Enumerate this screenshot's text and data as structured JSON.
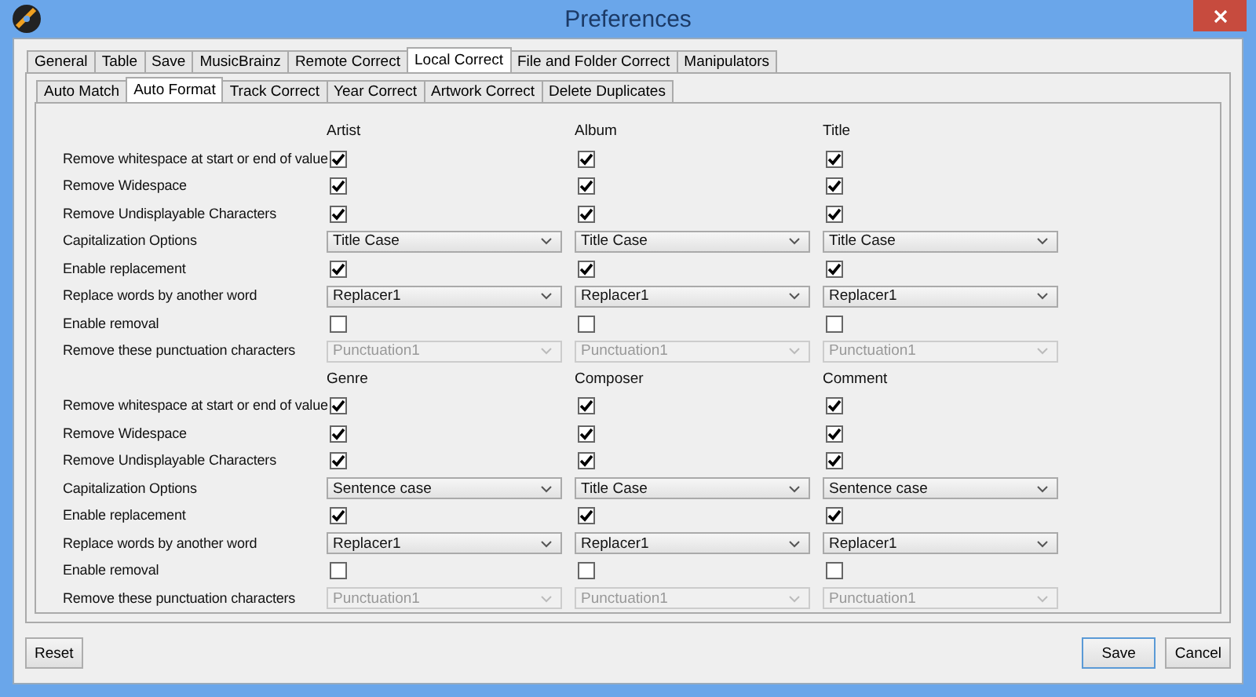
{
  "window": {
    "title": "Preferences"
  },
  "tabs": [
    {
      "label": "General",
      "selected": false
    },
    {
      "label": "Table",
      "selected": false
    },
    {
      "label": "Save",
      "selected": false
    },
    {
      "label": "MusicBrainz",
      "selected": false
    },
    {
      "label": "Remote Correct",
      "selected": false
    },
    {
      "label": "Local Correct",
      "selected": true
    },
    {
      "label": "File and Folder Correct",
      "selected": false
    },
    {
      "label": "Manipulators",
      "selected": false
    }
  ],
  "subtabs": [
    {
      "label": "Auto Match",
      "selected": false
    },
    {
      "label": "Auto Format",
      "selected": true
    },
    {
      "label": "Track Correct",
      "selected": false
    },
    {
      "label": "Year Correct",
      "selected": false
    },
    {
      "label": "Artwork Correct",
      "selected": false
    },
    {
      "label": "Delete Duplicates",
      "selected": false
    }
  ],
  "groups": [
    {
      "columns": [
        "Artist",
        "Album",
        "Title"
      ],
      "rows": [
        {
          "label": "Remove whitespace at start or end of value",
          "kind": "checkbox",
          "cells": [
            {
              "checked": true
            },
            {
              "checked": true
            },
            {
              "checked": true
            }
          ]
        },
        {
          "label": "Remove Widespace",
          "kind": "checkbox",
          "cells": [
            {
              "checked": true
            },
            {
              "checked": true
            },
            {
              "checked": true
            }
          ]
        },
        {
          "label": "Remove Undisplayable Characters",
          "kind": "checkbox",
          "cells": [
            {
              "checked": true
            },
            {
              "checked": true
            },
            {
              "checked": true
            }
          ]
        },
        {
          "label": "Capitalization Options",
          "kind": "dropdown",
          "cells": [
            {
              "value": "Title Case",
              "disabled": false
            },
            {
              "value": "Title Case",
              "disabled": false
            },
            {
              "value": "Title Case",
              "disabled": false
            }
          ]
        },
        {
          "label": "Enable replacement",
          "kind": "checkbox",
          "cells": [
            {
              "checked": true
            },
            {
              "checked": true
            },
            {
              "checked": true
            }
          ]
        },
        {
          "label": "Replace words by another word",
          "kind": "dropdown",
          "cells": [
            {
              "value": "Replacer1",
              "disabled": false
            },
            {
              "value": "Replacer1",
              "disabled": false
            },
            {
              "value": "Replacer1",
              "disabled": false
            }
          ]
        },
        {
          "label": "Enable removal",
          "kind": "checkbox",
          "cells": [
            {
              "checked": false
            },
            {
              "checked": false
            },
            {
              "checked": false
            }
          ]
        },
        {
          "label": "Remove these punctuation characters",
          "kind": "dropdown",
          "cells": [
            {
              "value": "Punctuation1",
              "disabled": true
            },
            {
              "value": "Punctuation1",
              "disabled": true
            },
            {
              "value": "Punctuation1",
              "disabled": true
            }
          ]
        }
      ]
    },
    {
      "columns": [
        "Genre",
        "Composer",
        "Comment"
      ],
      "rows": [
        {
          "label": "Remove whitespace at start or end of value",
          "kind": "checkbox",
          "cells": [
            {
              "checked": true
            },
            {
              "checked": true
            },
            {
              "checked": true
            }
          ]
        },
        {
          "label": "Remove Widespace",
          "kind": "checkbox",
          "cells": [
            {
              "checked": true
            },
            {
              "checked": true
            },
            {
              "checked": true
            }
          ]
        },
        {
          "label": "Remove Undisplayable Characters",
          "kind": "checkbox",
          "cells": [
            {
              "checked": true
            },
            {
              "checked": true
            },
            {
              "checked": true
            }
          ]
        },
        {
          "label": "Capitalization Options",
          "kind": "dropdown",
          "cells": [
            {
              "value": "Sentence case",
              "disabled": false
            },
            {
              "value": "Title Case",
              "disabled": false
            },
            {
              "value": "Sentence case",
              "disabled": false
            }
          ]
        },
        {
          "label": "Enable replacement",
          "kind": "checkbox",
          "cells": [
            {
              "checked": true
            },
            {
              "checked": true
            },
            {
              "checked": true
            }
          ]
        },
        {
          "label": "Replace words by another word",
          "kind": "dropdown",
          "cells": [
            {
              "value": "Replacer1",
              "disabled": false
            },
            {
              "value": "Replacer1",
              "disabled": false
            },
            {
              "value": "Replacer1",
              "disabled": false
            }
          ]
        },
        {
          "label": "Enable removal",
          "kind": "checkbox",
          "cells": [
            {
              "checked": false
            },
            {
              "checked": false
            },
            {
              "checked": false
            }
          ]
        },
        {
          "label": "Remove these punctuation characters",
          "kind": "dropdown",
          "cells": [
            {
              "value": "Punctuation1",
              "disabled": true
            },
            {
              "value": "Punctuation1",
              "disabled": true
            },
            {
              "value": "Punctuation1",
              "disabled": true
            }
          ]
        }
      ]
    }
  ],
  "buttons": {
    "left": "Reset",
    "right": [
      "Save",
      "Cancel"
    ]
  }
}
